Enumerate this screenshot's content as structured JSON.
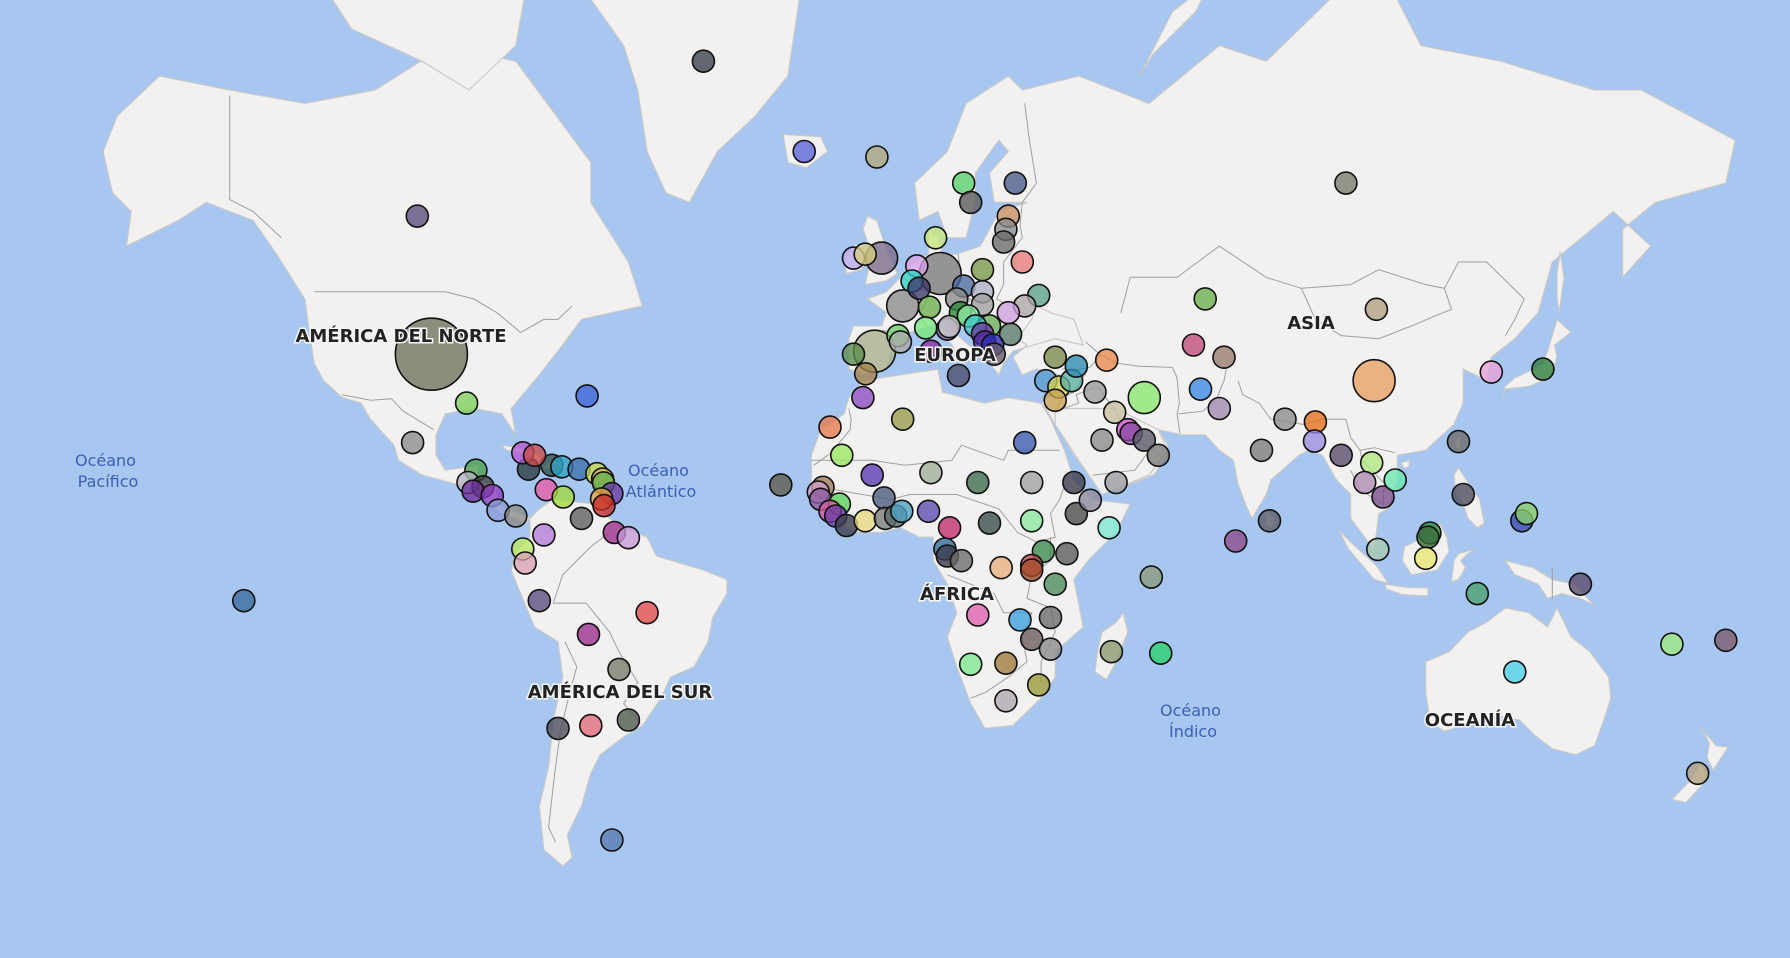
{
  "map": {
    "ocean_color": "#a7c6f0",
    "land_color": "#f2f1ef",
    "bubble_stroke": "#111111"
  },
  "continents": [
    {
      "name": "north-america",
      "label": "AMÉRICA DEL NORTE"
    },
    {
      "name": "south-america",
      "label": "AMÉRICA DEL SUR"
    },
    {
      "name": "europe",
      "label": "EUROPA"
    },
    {
      "name": "africa",
      "label": "ÁFRICA"
    },
    {
      "name": "asia",
      "label": "ASIA"
    },
    {
      "name": "oceania",
      "label": "OCEANÍA"
    }
  ],
  "oceans": [
    {
      "name": "pacific",
      "line1": "Océano",
      "line2": "Pacífico"
    },
    {
      "name": "atlantic",
      "line1": "Océano",
      "line2": "Atlántico"
    },
    {
      "name": "indian",
      "line1": "Océano",
      "line2": "Índico"
    }
  ],
  "bubbles": [
    {
      "lat": 72.0,
      "lon": -40.0,
      "color": "#3a3f4a",
      "size": 1
    },
    {
      "lat": 65.0,
      "lon": -18.5,
      "color": "#5a62d8",
      "size": 1
    },
    {
      "lat": 58.5,
      "lon": -101.0,
      "color": "#5a4a78",
      "size": 1
    },
    {
      "lat": 39.5,
      "lon": -98.0,
      "color": "#6e725b",
      "size": 6
    },
    {
      "lat": 31.0,
      "lon": -90.5,
      "color": "#7fcf5a",
      "size": 1
    },
    {
      "lat": 32.3,
      "lon": -64.8,
      "color": "#3f63d9",
      "size": 1
    },
    {
      "lat": 23.5,
      "lon": -102.0,
      "color": "#8c8c8c",
      "size": 1
    },
    {
      "lat": 18.2,
      "lon": -77.3,
      "color": "#2a3a40",
      "size": 1
    },
    {
      "lat": 21.5,
      "lon": -78.5,
      "color": "#b25ad2",
      "size": 1
    },
    {
      "lat": 19.0,
      "lon": -72.3,
      "color": "#2f4f4f",
      "size": 1
    },
    {
      "lat": 18.7,
      "lon": -70.2,
      "color": "#2aa1c2",
      "size": 1
    },
    {
      "lat": 18.2,
      "lon": -66.5,
      "color": "#3b6fa8",
      "size": 1
    },
    {
      "lat": 17.3,
      "lon": -62.7,
      "color": "#c8d850",
      "size": 1
    },
    {
      "lat": 16.2,
      "lon": -61.5,
      "color": "#d7b044",
      "size": 1
    },
    {
      "lat": 15.4,
      "lon": -61.3,
      "color": "#64b457",
      "size": 1
    },
    {
      "lat": 13.2,
      "lon": -59.5,
      "color": "#6b3aa0",
      "size": 1
    },
    {
      "lat": 12.1,
      "lon": -61.7,
      "color": "#e5a840",
      "size": 1
    },
    {
      "lat": 10.7,
      "lon": -61.2,
      "color": "#c32a2a",
      "size": 1
    },
    {
      "lat": 18.0,
      "lon": -88.5,
      "color": "#4a9f4f",
      "size": 1
    },
    {
      "lat": 15.5,
      "lon": -90.2,
      "color": "#b2b4c0",
      "size": 1
    },
    {
      "lat": 14.6,
      "lon": -87.0,
      "color": "#3d3d3d",
      "size": 1
    },
    {
      "lat": 13.7,
      "lon": -89.1,
      "color": "#6b2e9b",
      "size": 1
    },
    {
      "lat": 12.8,
      "lon": -85.0,
      "color": "#8c3ac0",
      "size": 1
    },
    {
      "lat": 9.7,
      "lon": -83.8,
      "color": "#8a9ad8",
      "size": 1
    },
    {
      "lat": 8.5,
      "lon": -80.0,
      "color": "#8a8a8a",
      "size": 1
    },
    {
      "lat": 21.0,
      "lon": -76.0,
      "color": "#c84a4a",
      "size": 1
    },
    {
      "lat": 14.0,
      "lon": -73.5,
      "color": "#e85aa8",
      "size": 1
    },
    {
      "lat": 12.5,
      "lon": -69.9,
      "color": "#a0d83c",
      "size": 1
    },
    {
      "lat": 8.0,
      "lon": -66.0,
      "color": "#5e5e5e",
      "size": 1
    },
    {
      "lat": 4.5,
      "lon": -74.0,
      "color": "#b47ad8",
      "size": 1
    },
    {
      "lat": 5.0,
      "lon": -59.0,
      "color": "#9a2a8c",
      "size": 1
    },
    {
      "lat": 3.9,
      "lon": -56.0,
      "color": "#c89ad8",
      "size": 1
    },
    {
      "lat": 1.5,
      "lon": -78.5,
      "color": "#b8e860",
      "size": 1
    },
    {
      "lat": -1.5,
      "lon": -78.0,
      "color": "#d8a0b4",
      "size": 1
    },
    {
      "lat": -9.5,
      "lon": -75.0,
      "color": "#5a4a80",
      "size": 1
    },
    {
      "lat": -12.0,
      "lon": -52.0,
      "color": "#e24a4a",
      "size": 1
    },
    {
      "lat": -16.5,
      "lon": -64.5,
      "color": "#9a2a8c",
      "size": 1
    },
    {
      "lat": -23.5,
      "lon": -58.0,
      "color": "#7a7a6a",
      "size": 1
    },
    {
      "lat": -33.0,
      "lon": -56.0,
      "color": "#4a5a4a",
      "size": 1
    },
    {
      "lat": -34.5,
      "lon": -71.0,
      "color": "#4a4a5a",
      "size": 1
    },
    {
      "lat": -34.0,
      "lon": -64.0,
      "color": "#e26a7a",
      "size": 1
    },
    {
      "lat": -51.7,
      "lon": -59.5,
      "color": "#5a7ab0",
      "size": 1
    },
    {
      "lat": -9.5,
      "lon": -138.0,
      "color": "#3a6a9a",
      "size": 1
    },
    {
      "lat": 64.5,
      "lon": -3.0,
      "color": "#b4a87a",
      "size": 1
    },
    {
      "lat": 62.0,
      "lon": 15.5,
      "color": "#5ad06a",
      "size": 1
    },
    {
      "lat": 62.0,
      "lon": 26.5,
      "color": "#4a5a8a",
      "size": 1
    },
    {
      "lat": 60.0,
      "lon": 17.0,
      "color": "#5a5a5a",
      "size": 1
    },
    {
      "lat": 58.5,
      "lon": 25.0,
      "color": "#c89060",
      "size": 1
    },
    {
      "lat": 57.0,
      "lon": 24.5,
      "color": "#8a8a8a",
      "size": 1
    },
    {
      "lat": 55.5,
      "lon": 24.0,
      "color": "#6a6a6a",
      "size": 1
    },
    {
      "lat": 56.0,
      "lon": 9.5,
      "color": "#c8e87a",
      "size": 1
    },
    {
      "lat": 53.5,
      "lon": -8.0,
      "color": "#b8a8e8",
      "size": 1
    },
    {
      "lat": 54.0,
      "lon": -5.5,
      "color": "#d8d080",
      "size": 1
    },
    {
      "lat": 53.5,
      "lon": -2.0,
      "color": "#7a6a8a",
      "size": 2
    },
    {
      "lat": 53.0,
      "lon": 28.0,
      "color": "#e87a7a",
      "size": 1
    },
    {
      "lat": 52.0,
      "lon": 19.5,
      "color": "#7a9a4a",
      "size": 1
    },
    {
      "lat": 51.5,
      "lon": 10.5,
      "color": "#7a7a7a",
      "size": 3
    },
    {
      "lat": 52.5,
      "lon": 5.5,
      "color": "#d8a0e8",
      "size": 1
    },
    {
      "lat": 50.5,
      "lon": 4.5,
      "color": "#2ad0c0",
      "size": 1
    },
    {
      "lat": 49.8,
      "lon": 15.5,
      "color": "#4a6aa0",
      "size": 1
    },
    {
      "lat": 49.0,
      "lon": 19.5,
      "color": "#b0b0c8",
      "size": 1
    },
    {
      "lat": 48.5,
      "lon": 31.5,
      "color": "#5aa08a",
      "size": 1
    },
    {
      "lat": 47.0,
      "lon": 28.5,
      "color": "#b0a8a8",
      "size": 1
    },
    {
      "lat": 46.0,
      "lon": 25.0,
      "color": "#d0a0e0",
      "size": 1
    },
    {
      "lat": 47.2,
      "lon": 19.5,
      "color": "#a0a0a0",
      "size": 1
    },
    {
      "lat": 48.0,
      "lon": 14.0,
      "color": "#8a8a8a",
      "size": 1
    },
    {
      "lat": 49.5,
      "lon": 6.0,
      "color": "#3a3a6a",
      "size": 1
    },
    {
      "lat": 47.0,
      "lon": 2.5,
      "color": "#8a8a8a",
      "size": 2
    },
    {
      "lat": 46.8,
      "lon": 8.2,
      "color": "#6ab04a",
      "size": 1
    },
    {
      "lat": 46.0,
      "lon": 14.8,
      "color": "#2a8a3a",
      "size": 1
    },
    {
      "lat": 45.5,
      "lon": 16.5,
      "color": "#8ae8a0",
      "size": 1
    },
    {
      "lat": 44.0,
      "lon": 21.0,
      "color": "#6ab05a",
      "size": 1
    },
    {
      "lat": 42.7,
      "lon": 25.5,
      "color": "#5a7a6a",
      "size": 1
    },
    {
      "lat": 44.0,
      "lon": 18.0,
      "color": "#3ac0c0",
      "size": 1
    },
    {
      "lat": 43.5,
      "lon": 12.0,
      "color": "#8a6aa0",
      "size": 1
    },
    {
      "lat": 42.8,
      "lon": 19.5,
      "color": "#6a3aa0",
      "size": 1
    },
    {
      "lat": 41.5,
      "lon": 20.0,
      "color": "#4a2a9a",
      "size": 1
    },
    {
      "lat": 41.0,
      "lon": 21.7,
      "color": "#2a2ab0",
      "size": 1
    },
    {
      "lat": 39.5,
      "lon": 22.0,
      "color": "#6a5a6a",
      "size": 1
    },
    {
      "lat": 40.0,
      "lon": 8.5,
      "color": "#8a2aa0",
      "size": 1
    },
    {
      "lat": 43.7,
      "lon": 7.4,
      "color": "#7ae87a",
      "size": 1
    },
    {
      "lat": 42.5,
      "lon": 1.5,
      "color": "#6ad06a",
      "size": 1
    },
    {
      "lat": 40.0,
      "lon": -3.5,
      "color": "#a8b08a",
      "size": 3
    },
    {
      "lat": 39.5,
      "lon": -8.0,
      "color": "#5a8a4a",
      "size": 1
    },
    {
      "lat": 36.2,
      "lon": -5.4,
      "color": "#a0804a",
      "size": 1
    },
    {
      "lat": 35.9,
      "lon": 14.4,
      "color": "#4a4a6a",
      "size": 1
    },
    {
      "lat": 41.5,
      "lon": 2.0,
      "color": "#aaaaaa",
      "size": 1
    },
    {
      "lat": 43.9,
      "lon": 12.4,
      "color": "#c8c8c8",
      "size": 1
    },
    {
      "lat": 35.0,
      "lon": 33.0,
      "color": "#5a9ad0",
      "size": 1
    },
    {
      "lat": 33.9,
      "lon": 35.8,
      "color": "#d0d050",
      "size": 1
    },
    {
      "lat": 31.5,
      "lon": 35.0,
      "color": "#c8a050",
      "size": 1
    },
    {
      "lat": 35.0,
      "lon": 38.5,
      "color": "#5ab0a0",
      "size": 1
    },
    {
      "lat": 33.0,
      "lon": 43.5,
      "color": "#9a9a9a",
      "size": 1
    },
    {
      "lat": 39.0,
      "lon": 35.0,
      "color": "#7a8a4a",
      "size": 1
    },
    {
      "lat": 38.5,
      "lon": 46.0,
      "color": "#e88a4a",
      "size": 1
    },
    {
      "lat": 37.5,
      "lon": 39.5,
      "color": "#2a8ab0",
      "size": 1
    },
    {
      "lat": 32.0,
      "lon": 54.0,
      "color": "#8ae870",
      "size": 2
    },
    {
      "lat": 29.3,
      "lon": 47.7,
      "color": "#c8c0a0",
      "size": 1
    },
    {
      "lat": 26.0,
      "lon": 50.5,
      "color": "#d05ad0",
      "size": 1
    },
    {
      "lat": 25.3,
      "lon": 51.2,
      "color": "#8a4aa0",
      "size": 1
    },
    {
      "lat": 24.0,
      "lon": 45.0,
      "color": "#8a8a8a",
      "size": 1
    },
    {
      "lat": 24.0,
      "lon": 54.0,
      "color": "#5a5a6a",
      "size": 1
    },
    {
      "lat": 21.0,
      "lon": 57.0,
      "color": "#7a7a7a",
      "size": 1
    },
    {
      "lat": 15.5,
      "lon": 48.0,
      "color": "#9a9aa0",
      "size": 1
    },
    {
      "lat": 48.0,
      "lon": 67.0,
      "color": "#6ab04a",
      "size": 1
    },
    {
      "lat": 41.0,
      "lon": 64.5,
      "color": "#c04a7a",
      "size": 1
    },
    {
      "lat": 39.0,
      "lon": 71.0,
      "color": "#9a7a6a",
      "size": 1
    },
    {
      "lat": 33.5,
      "lon": 66.0,
      "color": "#3a8ae8",
      "size": 1
    },
    {
      "lat": 30.0,
      "lon": 70.0,
      "color": "#a08ab0",
      "size": 1
    },
    {
      "lat": 28.0,
      "lon": 84.0,
      "color": "#8a8a8a",
      "size": 1
    },
    {
      "lat": 27.5,
      "lon": 90.5,
      "color": "#e8701a",
      "size": 1
    },
    {
      "lat": 23.8,
      "lon": 90.3,
      "color": "#9a8ae0",
      "size": 1
    },
    {
      "lat": 22.0,
      "lon": 79.0,
      "color": "#7a7a7a",
      "size": 1
    },
    {
      "lat": 7.5,
      "lon": 80.7,
      "color": "#5a5a6a",
      "size": 1
    },
    {
      "lat": 3.2,
      "lon": 73.5,
      "color": "#8a4a8a",
      "size": 1
    },
    {
      "lat": 62.0,
      "lon": 97.0,
      "color": "#7a7a6a",
      "size": 1
    },
    {
      "lat": 46.5,
      "lon": 103.5,
      "color": "#b0a080",
      "size": 1
    },
    {
      "lat": 35.0,
      "lon": 103.0,
      "color": "#e8a060",
      "size": 3
    },
    {
      "lat": 21.0,
      "lon": 96.0,
      "color": "#5a4a6a",
      "size": 1
    },
    {
      "lat": 19.5,
      "lon": 102.5,
      "color": "#b0e880",
      "size": 1
    },
    {
      "lat": 15.5,
      "lon": 101.0,
      "color": "#b08ab0",
      "size": 1
    },
    {
      "lat": 12.5,
      "lon": 104.9,
      "color": "#7a4a8a",
      "size": 1
    },
    {
      "lat": 16.0,
      "lon": 107.5,
      "color": "#6ae8b0",
      "size": 1
    },
    {
      "lat": 23.7,
      "lon": 121.0,
      "color": "#6a6a6a",
      "size": 1
    },
    {
      "lat": 13.0,
      "lon": 122.0,
      "color": "#4a4a5a",
      "size": 1
    },
    {
      "lat": 4.9,
      "lon": 114.9,
      "color": "#2a8a3a",
      "size": 1
    },
    {
      "lat": 4.0,
      "lon": 114.5,
      "color": "#3a6a3a",
      "size": 1
    },
    {
      "lat": 1.4,
      "lon": 103.8,
      "color": "#a8c8b0",
      "size": 1
    },
    {
      "lat": -0.5,
      "lon": 114.0,
      "color": "#e8e870",
      "size": 1
    },
    {
      "lat": 36.5,
      "lon": 128.0,
      "color": "#e8a0d8",
      "size": 1
    },
    {
      "lat": 37.0,
      "lon": 139.0,
      "color": "#2a7a3a",
      "size": 1
    },
    {
      "lat": 7.5,
      "lon": 134.5,
      "color": "#3a4ab0",
      "size": 1
    },
    {
      "lat": 9.0,
      "lon": 135.5,
      "color": "#8ad06a",
      "size": 1
    },
    {
      "lat": -8.0,
      "lon": 125.0,
      "color": "#4aa06a",
      "size": 1
    },
    {
      "lat": -6.0,
      "lon": 147.0,
      "color": "#5a4a6a",
      "size": 1
    },
    {
      "lat": -24.0,
      "lon": 133.0,
      "color": "#4ad0e8",
      "size": 1
    },
    {
      "lat": -17.7,
      "lon": 178.0,
      "color": "#7a5a6a",
      "size": 1
    },
    {
      "lat": -18.5,
      "lon": 166.5,
      "color": "#a0e880",
      "size": 1
    },
    {
      "lat": -42.0,
      "lon": 172.0,
      "color": "#b0a080",
      "size": 1
    },
    {
      "lat": 28.0,
      "lon": 2.5,
      "color": "#9a9a4a",
      "size": 1
    },
    {
      "lat": 32.0,
      "lon": -6.0,
      "color": "#8a4ac0",
      "size": 1
    },
    {
      "lat": 26.5,
      "lon": -13.0,
      "color": "#e87a4a",
      "size": 1
    },
    {
      "lat": 23.5,
      "lon": 28.5,
      "color": "#3a5ab0",
      "size": 1
    },
    {
      "lat": 21.0,
      "lon": -10.5,
      "color": "#9ae860",
      "size": 1
    },
    {
      "lat": 17.0,
      "lon": -4.0,
      "color": "#5a3ab0",
      "size": 1
    },
    {
      "lat": 17.5,
      "lon": 8.5,
      "color": "#a0b09a",
      "size": 1
    },
    {
      "lat": 15.5,
      "lon": 18.5,
      "color": "#3a6a4a",
      "size": 1
    },
    {
      "lat": 15.5,
      "lon": 30.0,
      "color": "#a0a0a0",
      "size": 1
    },
    {
      "lat": 15.0,
      "lon": -23.5,
      "color": "#5a5a4a",
      "size": 1
    },
    {
      "lat": 14.5,
      "lon": -14.5,
      "color": "#a07a5a",
      "size": 1
    },
    {
      "lat": 13.5,
      "lon": -15.5,
      "color": "#d0a0c0",
      "size": 1
    },
    {
      "lat": 12.0,
      "lon": -15.0,
      "color": "#8a5aa0",
      "size": 1
    },
    {
      "lat": 12.3,
      "lon": -1.5,
      "color": "#4a5a7a",
      "size": 1
    },
    {
      "lat": 11.0,
      "lon": -11.0,
      "color": "#5ad05a",
      "size": 1
    },
    {
      "lat": 9.5,
      "lon": -13.0,
      "color": "#d05aa0",
      "size": 1
    },
    {
      "lat": 8.5,
      "lon": -11.8,
      "color": "#6a3aa0",
      "size": 1
    },
    {
      "lat": 6.5,
      "lon": -9.5,
      "color": "#3a3a4a",
      "size": 1
    },
    {
      "lat": 7.5,
      "lon": -5.5,
      "color": "#e8d880",
      "size": 1
    },
    {
      "lat": 8.0,
      "lon": -1.2,
      "color": "#7a7a7a",
      "size": 1
    },
    {
      "lat": 8.5,
      "lon": 1.0,
      "color": "#5a6a6a",
      "size": 1
    },
    {
      "lat": 9.5,
      "lon": 2.3,
      "color": "#4aa0c0",
      "size": 1
    },
    {
      "lat": 9.5,
      "lon": 8.0,
      "color": "#5a4ab0",
      "size": 1
    },
    {
      "lat": 6.0,
      "lon": 12.5,
      "color": "#c02a6a",
      "size": 1
    },
    {
      "lat": 7.0,
      "lon": 21.0,
      "color": "#3a4a4a",
      "size": 1
    },
    {
      "lat": 9.0,
      "lon": 39.5,
      "color": "#4a4a4a",
      "size": 1
    },
    {
      "lat": 11.8,
      "lon": 42.5,
      "color": "#8a8a9a",
      "size": 1
    },
    {
      "lat": 15.5,
      "lon": 39.0,
      "color": "#3a3a4a",
      "size": 1
    },
    {
      "lat": 6.0,
      "lon": 46.5,
      "color": "#7ae8d0",
      "size": 1
    },
    {
      "lat": 7.5,
      "lon": 30.0,
      "color": "#8ae8a0",
      "size": 1
    },
    {
      "lat": 1.5,
      "lon": 11.5,
      "color": "#2a6a9a",
      "size": 1
    },
    {
      "lat": 0.0,
      "lon": 12.0,
      "color": "#3a3a4a",
      "size": 1
    },
    {
      "lat": -1.0,
      "lon": 15.0,
      "color": "#6a6a6a",
      "size": 1
    },
    {
      "lat": -2.5,
      "lon": 23.5,
      "color": "#e8b080",
      "size": 1
    },
    {
      "lat": 1.0,
      "lon": 32.5,
      "color": "#3a8a4a",
      "size": 1
    },
    {
      "lat": 0.5,
      "lon": 37.5,
      "color": "#5a5a5a",
      "size": 1
    },
    {
      "lat": -2.0,
      "lon": 30.0,
      "color": "#c84a4a",
      "size": 1
    },
    {
      "lat": -3.0,
      "lon": 30.0,
      "color": "#a04a2a",
      "size": 1
    },
    {
      "lat": -6.0,
      "lon": 35.0,
      "color": "#4a8a5a",
      "size": 1
    },
    {
      "lat": -12.5,
      "lon": 18.5,
      "color": "#e060b0",
      "size": 1
    },
    {
      "lat": -13.5,
      "lon": 27.5,
      "color": "#3aa0e0",
      "size": 1
    },
    {
      "lat": -13.0,
      "lon": 34.0,
      "color": "#6a6a6a",
      "size": 1
    },
    {
      "lat": -17.5,
      "lon": 30.0,
      "color": "#6a5a5a",
      "size": 1
    },
    {
      "lat": -19.5,
      "lon": 34.0,
      "color": "#8a8a8a",
      "size": 1
    },
    {
      "lat": -22.5,
      "lon": 17.0,
      "color": "#80e890",
      "size": 1
    },
    {
      "lat": -22.3,
      "lon": 24.5,
      "color": "#a07a3a",
      "size": 1
    },
    {
      "lat": -29.5,
      "lon": 24.5,
      "color": "#b0a8b0",
      "size": 1
    },
    {
      "lat": -26.5,
      "lon": 31.5,
      "color": "#9a9a3a",
      "size": 1
    },
    {
      "lat": -20.0,
      "lon": 47.0,
      "color": "#8a9a6a",
      "size": 1
    },
    {
      "lat": -20.3,
      "lon": 57.5,
      "color": "#2ad06a",
      "size": 1
    },
    {
      "lat": -4.5,
      "lon": 55.5,
      "color": "#8a9a7a",
      "size": 1
    }
  ]
}
